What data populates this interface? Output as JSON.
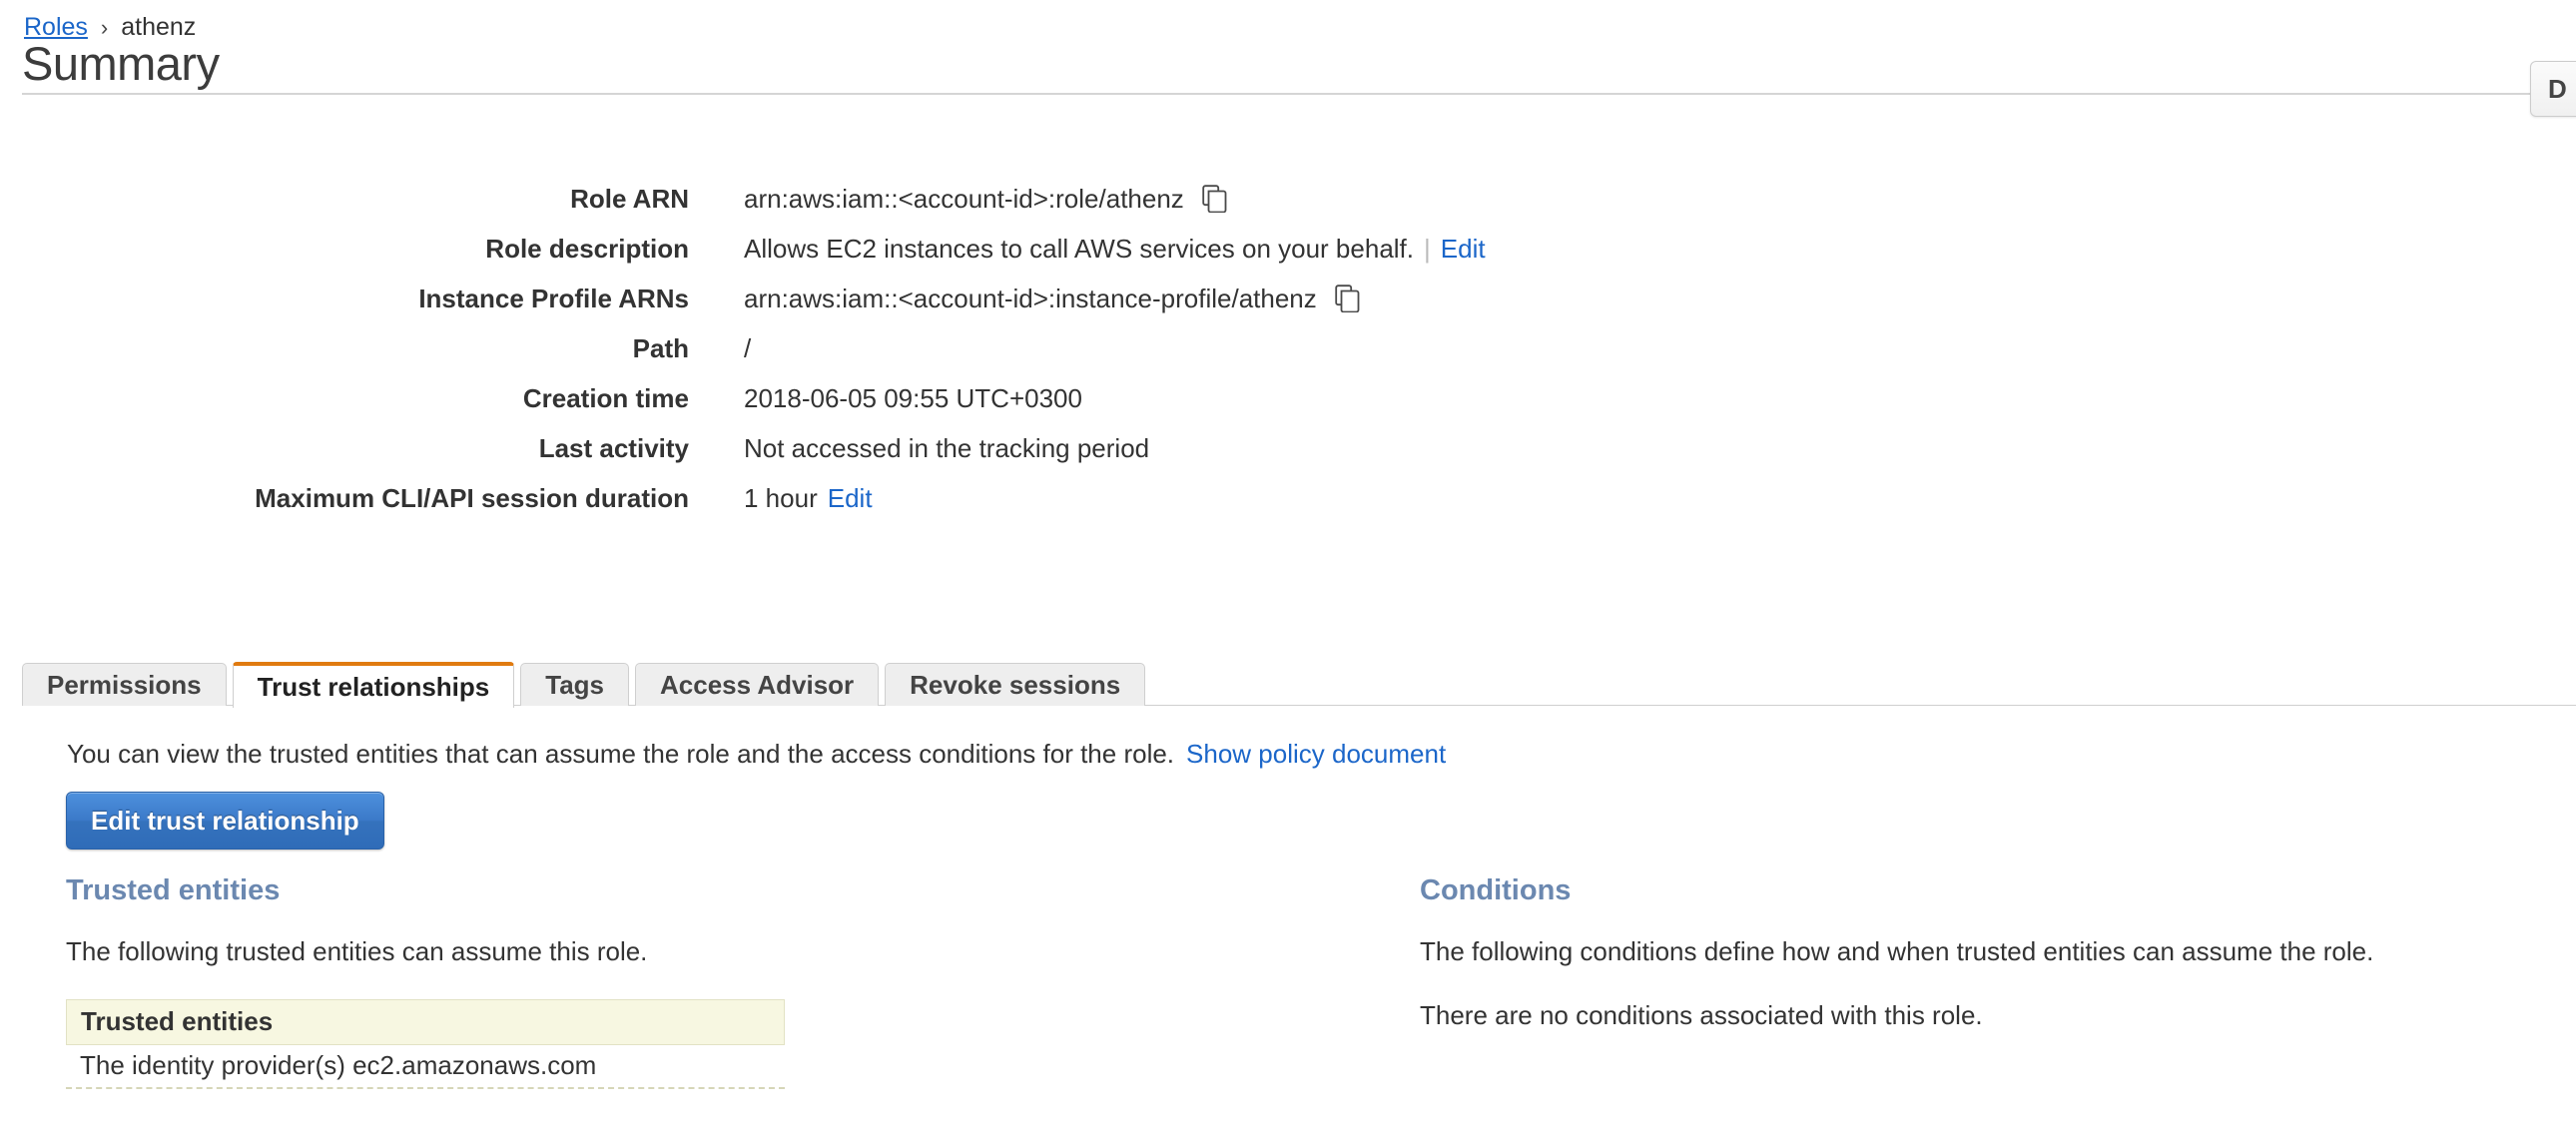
{
  "breadcrumb": {
    "link_label": "Roles",
    "separator": "›",
    "current": "athenz"
  },
  "page_title": "Summary",
  "header_actions": {
    "delete_button_label": "D"
  },
  "details": [
    {
      "label": "Role ARN",
      "value": "arn:aws:iam::<account-id>:role/athenz",
      "copy_icon": "copy-icon",
      "has_copy": true
    },
    {
      "label": "Role description",
      "value": "Allows EC2 instances to call AWS services on your behalf.",
      "edit_label": "Edit",
      "has_pipe_edit": true
    },
    {
      "label": "Instance Profile ARNs",
      "value": "arn:aws:iam::<account-id>:instance-profile/athenz",
      "copy_icon": "copy-icon",
      "has_copy": true
    },
    {
      "label": "Path",
      "value": "/"
    },
    {
      "label": "Creation time",
      "value": "2018-06-05 09:55 UTC+0300"
    },
    {
      "label": "Last activity",
      "value": "Not accessed in the tracking period"
    },
    {
      "label": "Maximum CLI/API session duration",
      "value": "1 hour",
      "edit_label": "Edit",
      "has_trailing_edit": true
    }
  ],
  "tabs": [
    {
      "label": "Permissions",
      "active": false
    },
    {
      "label": "Trust relationships",
      "active": true
    },
    {
      "label": "Tags",
      "active": false
    },
    {
      "label": "Access Advisor",
      "active": false
    },
    {
      "label": "Revoke sessions",
      "active": false
    }
  ],
  "trust_panel": {
    "intro_text": "You can view the trusted entities that can assume the role and the access conditions for the role.",
    "show_policy_link": "Show policy document",
    "edit_button_label": "Edit trust relationship",
    "trusted_entities": {
      "heading": "Trusted entities",
      "description": "The following trusted entities can assume this role.",
      "table_header": "Trusted entities",
      "rows": [
        "The identity provider(s) ec2.amazonaws.com"
      ]
    },
    "conditions": {
      "heading": "Conditions",
      "description": "The following conditions define how and when trusted entities can assume the role.",
      "empty_text": "There are no conditions associated with this role."
    }
  },
  "colors": {
    "link_blue": "#1b66c9",
    "active_tab_orange": "#e07b10",
    "section_heading_blue": "#6b88b0",
    "table_header_beige": "#f7f7e1",
    "primary_button_blue": "#3b79c8"
  }
}
